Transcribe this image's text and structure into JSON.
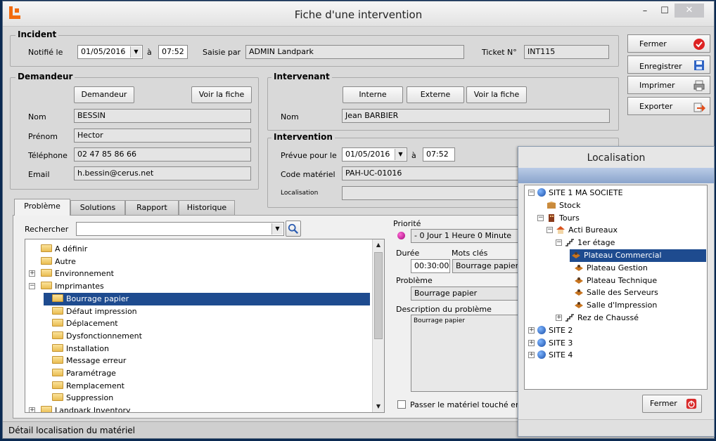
{
  "window": {
    "title": "Fiche d'une intervention",
    "minimize": "–",
    "maximize": "☐",
    "close": "✕"
  },
  "incident": {
    "legend": "Incident",
    "notified_label": "Notifié le",
    "notified_date": "01/05/2016",
    "at": "à",
    "notified_time": "07:52",
    "entered_by_label": "Saisie par",
    "entered_by": "ADMIN Landpark",
    "ticket_label": "Ticket N°",
    "ticket": "INT115"
  },
  "requester": {
    "legend": "Demandeur",
    "btn_requester": "Demandeur",
    "btn_view": "Voir la fiche",
    "name_label": "Nom",
    "name": "BESSIN",
    "firstname_label": "Prénom",
    "firstname": "Hector",
    "phone_label": "Téléphone",
    "phone": "02 47 85 86 66",
    "email_label": "Email",
    "email": "h.bessin@cerus.net"
  },
  "technician": {
    "legend": "Intervenant",
    "btn_internal": "Interne",
    "btn_external": "Externe",
    "btn_view": "Voir la fiche",
    "name_label": "Nom",
    "name": "Jean BARBIER"
  },
  "intervention": {
    "legend": "Intervention",
    "planned_label": "Prévue pour le",
    "planned_date": "01/05/2016",
    "at": "à",
    "planned_time": "07:52",
    "equipment_label": "Code matériel",
    "equipment": "PAH-UC-01016",
    "location_label": "Localisation",
    "location": ""
  },
  "side_buttons": [
    {
      "label": "Fermer"
    },
    {
      "label": "Enregistrer"
    },
    {
      "label": "Imprimer"
    },
    {
      "label": "Exporter"
    }
  ],
  "tabs": [
    "Problème",
    "Solutions",
    "Rapport",
    "Historique"
  ],
  "problem": {
    "search_label": "Rechercher",
    "search_value": "",
    "tree": [
      {
        "label": "A définir",
        "level": 0,
        "expander": ""
      },
      {
        "label": "Autre",
        "level": 0,
        "expander": ""
      },
      {
        "label": "Environnement",
        "level": 0,
        "expander": "+"
      },
      {
        "label": "Imprimantes",
        "level": 0,
        "expander": "−"
      },
      {
        "label": "Bourrage papier",
        "level": 1,
        "expander": "",
        "selected": true
      },
      {
        "label": "Défaut impression",
        "level": 1,
        "expander": ""
      },
      {
        "label": "Déplacement",
        "level": 1,
        "expander": ""
      },
      {
        "label": "Dysfonctionnement",
        "level": 1,
        "expander": ""
      },
      {
        "label": "Installation",
        "level": 1,
        "expander": ""
      },
      {
        "label": "Message erreur",
        "level": 1,
        "expander": ""
      },
      {
        "label": "Paramétrage",
        "level": 1,
        "expander": ""
      },
      {
        "label": "Remplacement",
        "level": 1,
        "expander": ""
      },
      {
        "label": "Suppression",
        "level": 1,
        "expander": ""
      },
      {
        "label": "Landpark Inventory",
        "level": 0,
        "expander": "+"
      }
    ],
    "priority_label": "Priorité",
    "priority_value": "- 0 Jour 1 Heure 0 Minute",
    "duration_label": "Durée",
    "duration": "00:30:00",
    "keywords_label": "Mots clés",
    "keywords": "Bourrage papier",
    "problem_label": "Problème",
    "problem_value": "Bourrage papier",
    "description_label": "Description du problème",
    "description": "Bourrage papier",
    "checkbox_label": "Passer le matériel touché en ma"
  },
  "statusbar": {
    "text": "Détail localisation du matériel"
  },
  "location_popup": {
    "title": "Localisation",
    "tree": [
      {
        "label": "SITE 1 MA SOCIETE",
        "level": 0,
        "icon": "globe",
        "expander": "−"
      },
      {
        "label": "Stock",
        "level": 1,
        "icon": "box",
        "expander": ""
      },
      {
        "label": "Tours",
        "level": 1,
        "icon": "building",
        "expander": "−"
      },
      {
        "label": "Acti Bureaux",
        "level": 2,
        "icon": "house",
        "expander": "−"
      },
      {
        "label": "1er étage",
        "level": 3,
        "icon": "stairs",
        "expander": "−"
      },
      {
        "label": "Plateau Commercial",
        "level": 4,
        "icon": "desk",
        "expander": "",
        "selected": true
      },
      {
        "label": "Plateau Gestion",
        "level": 4,
        "icon": "desk",
        "expander": ""
      },
      {
        "label": "Plateau Technique",
        "level": 4,
        "icon": "desk",
        "expander": ""
      },
      {
        "label": "Salle des Serveurs",
        "level": 4,
        "icon": "desk",
        "expander": ""
      },
      {
        "label": "Salle d'Impression",
        "level": 4,
        "icon": "desk",
        "expander": ""
      },
      {
        "label": "Rez de Chaussé",
        "level": 3,
        "icon": "stairs",
        "expander": "+"
      },
      {
        "label": "SITE 2",
        "level": 0,
        "icon": "globe",
        "expander": "+"
      },
      {
        "label": "SITE 3",
        "level": 0,
        "icon": "globe",
        "expander": "+"
      },
      {
        "label": "SITE 4",
        "level": 0,
        "icon": "globe",
        "expander": "+"
      }
    ],
    "close_label": "Fermer"
  }
}
